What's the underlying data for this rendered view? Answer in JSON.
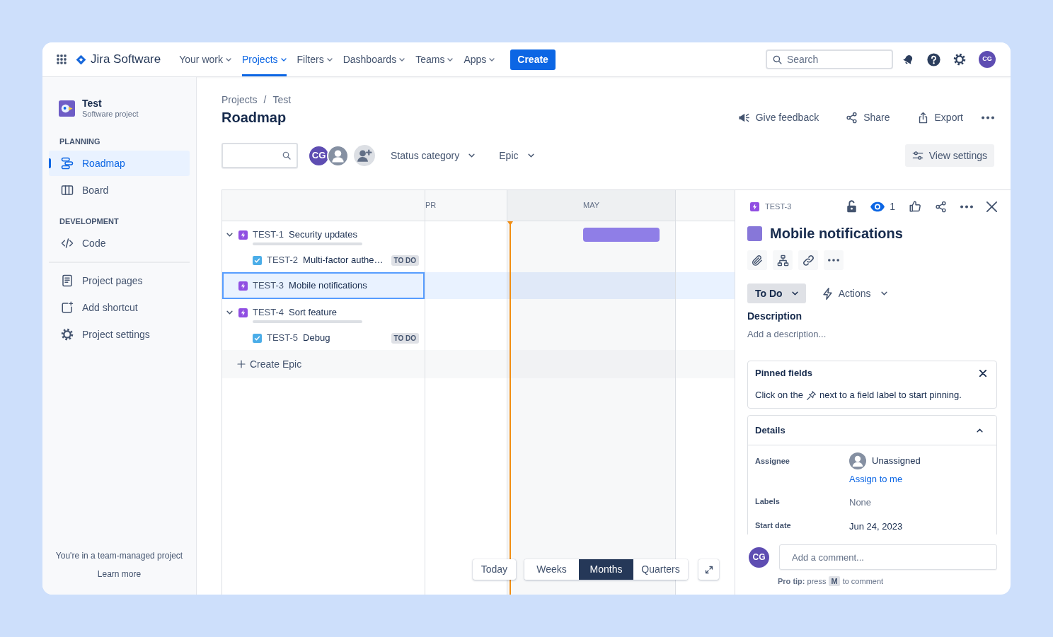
{
  "topnav": {
    "logo": "Jira Software",
    "items": [
      {
        "label": "Your work",
        "selected": false
      },
      {
        "label": "Projects",
        "selected": true
      },
      {
        "label": "Filters",
        "selected": false
      },
      {
        "label": "Dashboards",
        "selected": false
      },
      {
        "label": "Teams",
        "selected": false
      },
      {
        "label": "Apps",
        "selected": false
      }
    ],
    "create": "Create",
    "search": {
      "placeholder": "Search"
    },
    "avatar": "CG"
  },
  "sidebar": {
    "project": {
      "name": "Test",
      "subtitle": "Software project"
    },
    "groups": [
      {
        "heading": "PLANNING",
        "items": [
          {
            "label": "Roadmap",
            "selected": true
          },
          {
            "label": "Board",
            "selected": false
          }
        ]
      },
      {
        "heading": "DEVELOPMENT",
        "items": [
          {
            "label": "Code",
            "selected": false
          }
        ]
      },
      {
        "items": [
          {
            "label": "Project pages",
            "selected": false
          },
          {
            "label": "Add shortcut",
            "selected": false
          },
          {
            "label": "Project settings",
            "selected": false
          }
        ]
      }
    ],
    "footer": {
      "text": "You're in a team-managed project",
      "link": "Learn more"
    }
  },
  "header": {
    "breadcrumbs": [
      "Projects",
      "Test"
    ],
    "separator": "/",
    "title": "Roadmap",
    "actions": [
      "Give feedback",
      "Share",
      "Export"
    ]
  },
  "filters": {
    "avatar": "CG",
    "dropdowns": [
      "Status category",
      "Epic"
    ],
    "view_settings": "View settings"
  },
  "roadmap": {
    "months": [
      {
        "label": "PR",
        "current": false
      },
      {
        "label": "MAY",
        "current": true
      }
    ],
    "rows": [
      {
        "kind": "epic",
        "key": "TEST-1",
        "summary": "Security updates",
        "selected": false,
        "expanded": true,
        "level": 0,
        "scheduled": true,
        "children": [
          {
            "kind": "task",
            "key": "TEST-2",
            "summary": "Multi-factor authe…",
            "status": "TO DO",
            "selected": false
          }
        ]
      },
      {
        "kind": "epic",
        "key": "TEST-3",
        "summary": "Mobile notifications",
        "selected": true,
        "scheduled": false
      },
      {
        "kind": "epic",
        "key": "TEST-4",
        "summary": "Sort feature",
        "selected": false,
        "expanded": true,
        "level": 0,
        "scheduled": false,
        "children": [
          {
            "kind": "task",
            "key": "TEST-5",
            "summary": "Debug",
            "status": "TO DO",
            "selected": false
          }
        ]
      }
    ],
    "create": "Create Epic",
    "today": "Today",
    "scales": [
      {
        "label": "Weeks",
        "selected": false
      },
      {
        "label": "Months",
        "selected": true
      },
      {
        "label": "Quarters",
        "selected": false
      }
    ]
  },
  "issue": {
    "key": "TEST-3",
    "watchers": "1",
    "title": "Mobile notifications",
    "status": "To Do",
    "actions": "Actions",
    "description": {
      "label": "Description",
      "prompt": "Add a description..."
    },
    "pinned": {
      "title": "Pinned fields",
      "hint_start": "Click on the",
      "hint_end": "next to a field label to start pinning."
    },
    "details": {
      "title": "Details",
      "expanded": true,
      "fields": [
        {
          "kind": "user",
          "label": "Assignee",
          "value": "Unassigned",
          "link": "Assign to me"
        },
        {
          "kind": "empty",
          "label": "Labels",
          "value": "None"
        },
        {
          "kind": "text",
          "label": "Start date",
          "value": "Jun 24, 2023"
        }
      ]
    },
    "comment": {
      "avatar": "CG",
      "placeholder": "Add a comment...",
      "tip": "**Pro tip:** press",
      "key": "M",
      "tip_end": "to comment"
    }
  }
}
